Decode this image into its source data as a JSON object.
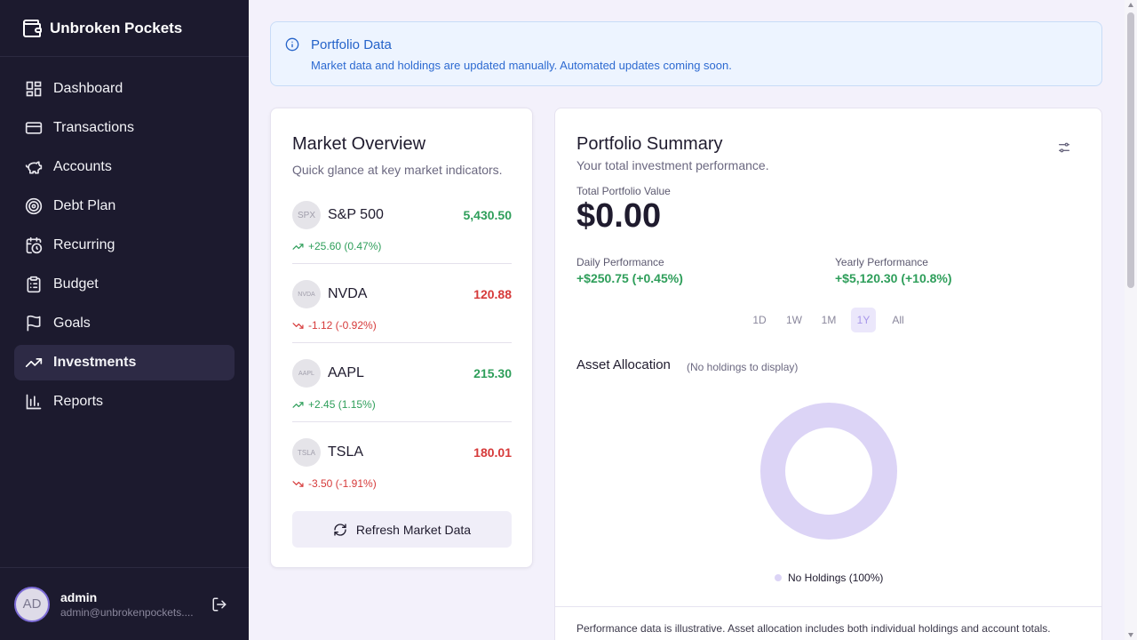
{
  "app": {
    "name": "Unbroken Pockets"
  },
  "sidebar": {
    "items": [
      {
        "label": "Dashboard",
        "icon": "dashboard-icon"
      },
      {
        "label": "Transactions",
        "icon": "credit-card-icon"
      },
      {
        "label": "Accounts",
        "icon": "piggy-bank-icon"
      },
      {
        "label": "Debt Plan",
        "icon": "target-icon"
      },
      {
        "label": "Recurring",
        "icon": "calendar-clock-icon"
      },
      {
        "label": "Budget",
        "icon": "clipboard-icon"
      },
      {
        "label": "Goals",
        "icon": "flag-icon"
      },
      {
        "label": "Investments",
        "icon": "trending-up-icon",
        "active": true
      },
      {
        "label": "Reports",
        "icon": "bar-chart-icon"
      }
    ],
    "user": {
      "initials": "AD",
      "name": "admin",
      "email": "admin@unbrokenpockets...."
    }
  },
  "alert": {
    "title": "Portfolio Data",
    "message": "Market data and holdings are updated manually. Automated updates coming soon."
  },
  "market": {
    "title": "Market Overview",
    "subtitle": "Quick glance at key market indicators.",
    "tickers": [
      {
        "badge": "SPX",
        "name": "S&P 500",
        "price": "5,430.50",
        "change": "+25.60 (0.47%)",
        "direction": "up"
      },
      {
        "badge": "NVDA",
        "name": "NVDA",
        "price": "120.88",
        "change": "-1.12 (-0.92%)",
        "direction": "down"
      },
      {
        "badge": "AAPL",
        "name": "AAPL",
        "price": "215.30",
        "change": "+2.45 (1.15%)",
        "direction": "up"
      },
      {
        "badge": "TSLA",
        "name": "TSLA",
        "price": "180.01",
        "change": "-3.50 (-1.91%)",
        "direction": "down"
      }
    ],
    "refresh_label": "Refresh Market Data"
  },
  "summary": {
    "title": "Portfolio Summary",
    "subtitle": "Your total investment performance.",
    "total_label": "Total Portfolio Value",
    "total_value": "$0.00",
    "daily_label": "Daily Performance",
    "daily_value": "+$250.75 (+0.45%)",
    "yearly_label": "Yearly Performance",
    "yearly_value": "+$5,120.30 (+10.8%)",
    "ranges": [
      "1D",
      "1W",
      "1M",
      "1Y",
      "All"
    ],
    "active_range": "1Y",
    "allocation_title": "Asset Allocation",
    "allocation_note": "(No holdings to display)",
    "legend_label": "No Holdings (100%)",
    "footnote": "Performance data is illustrative. Asset allocation includes both individual holdings and account totals."
  },
  "colors": {
    "sidebar_bg": "#1c1a2e",
    "up": "#2e9e5a",
    "down": "#d63a3a",
    "donut": "#dcd4f6",
    "accent": "#7c6bd6"
  }
}
